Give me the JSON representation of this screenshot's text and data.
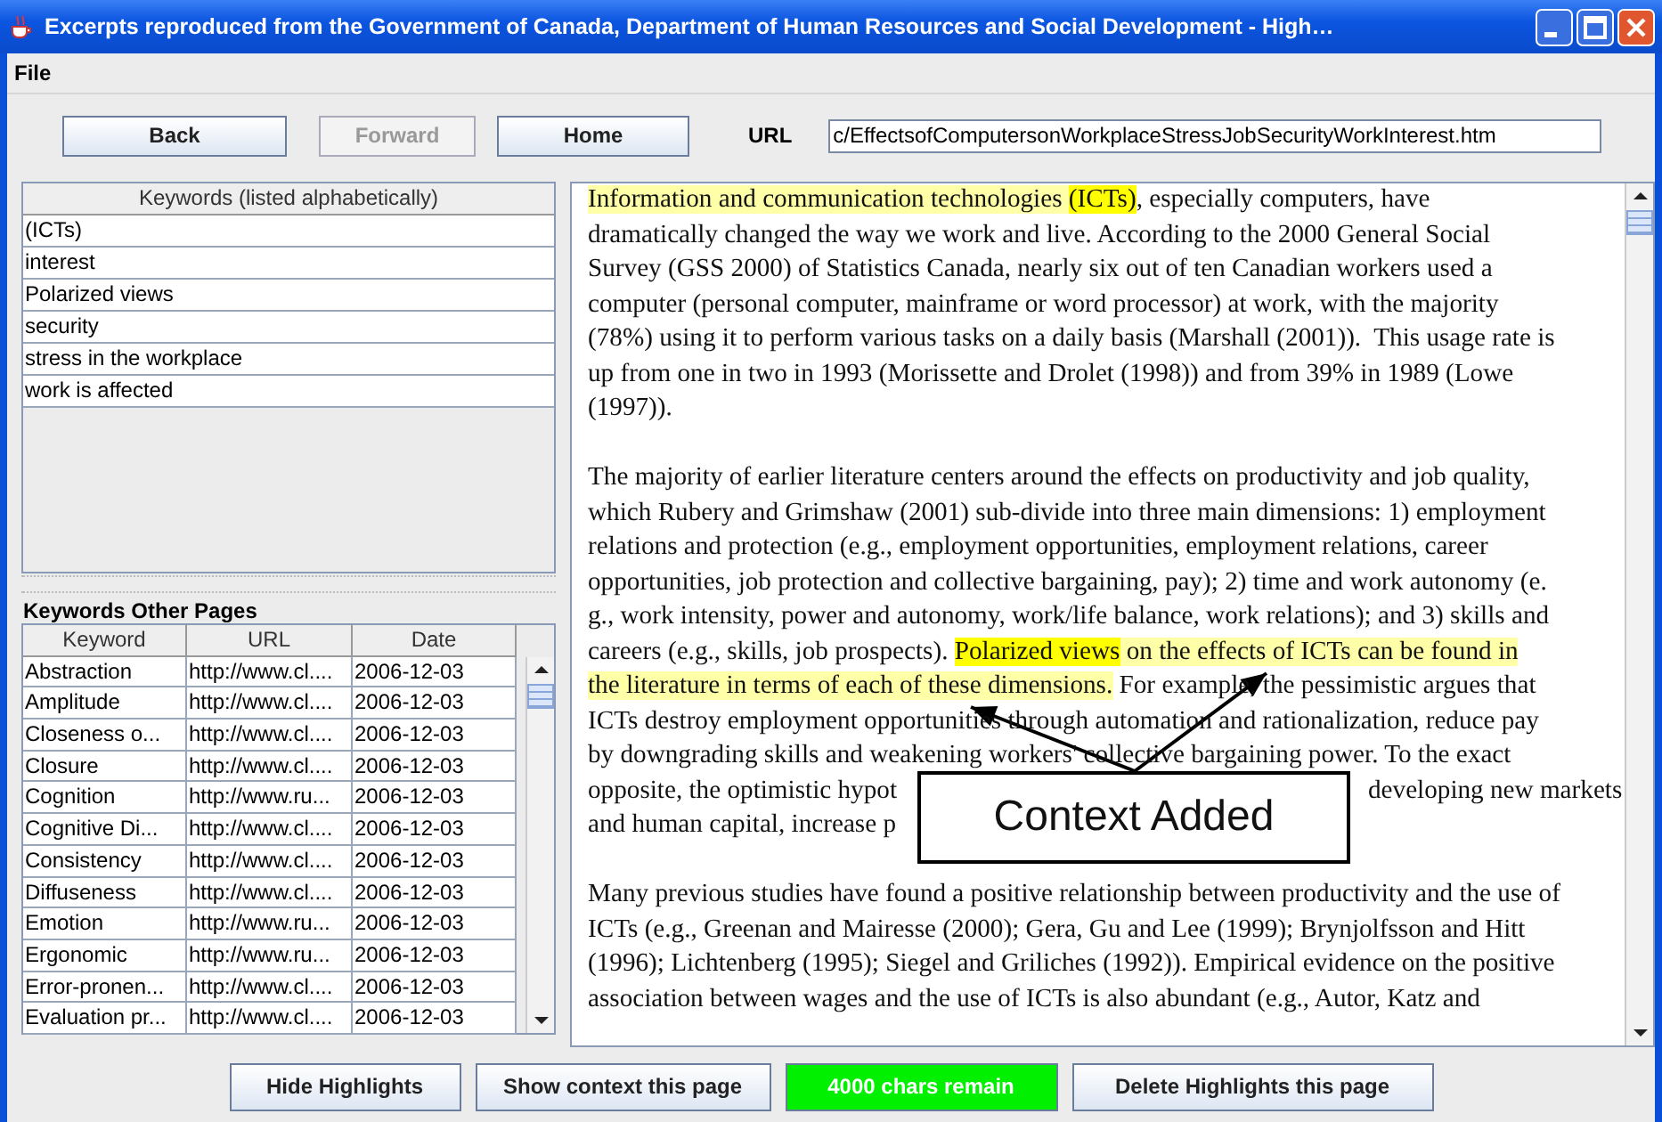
{
  "window": {
    "title": "Excerpts reproduced from the Government of Canada, Department of Human Resources and Social Development - High…"
  },
  "menu": [
    "File"
  ],
  "toolbar": {
    "buttons": [
      {
        "label": "Back",
        "disabled": false
      },
      {
        "label": "Forward",
        "disabled": true
      },
      {
        "label": "Home",
        "disabled": false
      }
    ],
    "url_label": "URL",
    "url": "c/EffectsofComputersonWorkplaceStressJobSecurityWorkInterest.htm"
  },
  "keywords": {
    "header": "Keywords (listed alphabetically)",
    "items": [
      "(ICTs)",
      "interest",
      "Polarized views",
      "security",
      "stress in the workplace",
      "work is affected"
    ]
  },
  "other_pages": {
    "title": "Keywords Other Pages",
    "columns": [
      "Keyword",
      "URL",
      "Date"
    ],
    "rows": [
      [
        "Abstraction",
        "http://www.cl....",
        "2006-12-03"
      ],
      [
        "Amplitude",
        "http://www.cl....",
        "2006-12-03"
      ],
      [
        "Closeness o...",
        "http://www.cl....",
        "2006-12-03"
      ],
      [
        "Closure",
        "http://www.cl....",
        "2006-12-03"
      ],
      [
        "Cognition",
        "http://www.ru...",
        "2006-12-03"
      ],
      [
        "Cognitive Di...",
        "http://www.cl....",
        "2006-12-03"
      ],
      [
        "Consistency",
        "http://www.cl....",
        "2006-12-03"
      ],
      [
        "Diffuseness",
        "http://www.cl....",
        "2006-12-03"
      ],
      [
        "Emotion",
        "http://www.ru...",
        "2006-12-03"
      ],
      [
        "Ergonomic",
        "http://www.ru...",
        "2006-12-03"
      ],
      [
        "Error-pronen...",
        "http://www.cl....",
        "2006-12-03"
      ],
      [
        "Evaluation pr...",
        "http://www.cl....",
        "2006-12-03"
      ]
    ]
  },
  "document": {
    "paragraphs": [
      {
        "lines": [
          [
            {
              "text": "Information and communication technologies ",
              "kind": "context"
            },
            {
              "text": "(ICTs)",
              "kind": "keyword"
            },
            {
              "text": ", especially computers, have",
              "kind": "plain"
            }
          ],
          [
            {
              "text": "dramatically changed the way we work and live. According to the 2000 General Social",
              "kind": "plain"
            }
          ],
          [
            {
              "text": "Survey (GSS 2000) of Statistics Canada, nearly six out of ten Canadian workers used a",
              "kind": "plain"
            }
          ],
          [
            {
              "text": "computer (personal computer, mainframe or word processor) at work, with the majority",
              "kind": "plain"
            }
          ],
          [
            {
              "text": "(78%) using it to perform various tasks on a daily basis (Marshall (2001)).  This usage rate is",
              "kind": "plain"
            }
          ],
          [
            {
              "text": "up from one in two in 1993 (Morissette and Drolet (1998)) and from 39% in 1989 (Lowe",
              "kind": "plain"
            }
          ],
          [
            {
              "text": "(1997)).",
              "kind": "plain"
            }
          ]
        ]
      },
      {
        "lines": [
          [
            {
              "text": "The majority of earlier literature centers around the effects on productivity and job quality,",
              "kind": "plain"
            }
          ],
          [
            {
              "text": "which Rubery and Grimshaw (2001) sub-divide into three main dimensions: 1) employment",
              "kind": "plain"
            }
          ],
          [
            {
              "text": "relations and protection (e.g., employment opportunities, employment relations, career",
              "kind": "plain"
            }
          ],
          [
            {
              "text": "opportunities, job protection and collective bargaining, pay); 2) time and work autonomy (e.",
              "kind": "plain"
            }
          ],
          [
            {
              "text": "g., work intensity, power and autonomy, work/life balance, work relations); and 3) skills and",
              "kind": "plain"
            }
          ],
          [
            {
              "text": "careers (e.g., skills, job prospects). ",
              "kind": "plain"
            },
            {
              "text": "Polarized views",
              "kind": "keyword"
            },
            {
              "text": " on the effects of ICTs can be found in",
              "kind": "context"
            }
          ],
          [
            {
              "text": "the literature in terms of each of these dimensions.",
              "kind": "context"
            },
            {
              "text": " For example, the pessimistic argues that",
              "kind": "plain"
            }
          ],
          [
            {
              "text": "ICTs destroy employment opportunities through automation and rationalization, reduce pay",
              "kind": "plain"
            }
          ],
          [
            {
              "text": "by downgrading skills and weakening workers' collective bargaining power. To the exact",
              "kind": "plain"
            }
          ],
          [
            {
              "text": "opposite, the optimistic hypot",
              "kind": "plain"
            },
            {
              "text": "developing new markets",
              "kind": "plain"
            }
          ],
          [
            {
              "text": "and human capital, increase p",
              "kind": "plain"
            }
          ]
        ]
      },
      {
        "lines": [
          [
            {
              "text": "Many previous studies have found a positive relationship between productivity and the use of",
              "kind": "plain"
            }
          ],
          [
            {
              "text": "ICTs (e.g., Greenan and Mairesse (2000); Gera, Gu and Lee (1999); Brynjolfsson and Hitt",
              "kind": "plain"
            }
          ],
          [
            {
              "text": "(1996); Lichtenberg (1995); Siegel and Griliches (1992)). Empirical evidence on the positive",
              "kind": "plain"
            }
          ],
          [
            {
              "text": "association between wages and the use of ICTs is also abundant (e.g., Autor, Katz and",
              "kind": "plain"
            }
          ]
        ]
      }
    ],
    "callout": "Context Added"
  },
  "bottom_buttons": [
    {
      "label": "Hide Highlights",
      "kind": "button"
    },
    {
      "label": "Show context this page",
      "kind": "button"
    },
    {
      "label": "4000 chars remain",
      "kind": "counter"
    },
    {
      "label": "Delete Highlights this page",
      "kind": "button"
    }
  ]
}
